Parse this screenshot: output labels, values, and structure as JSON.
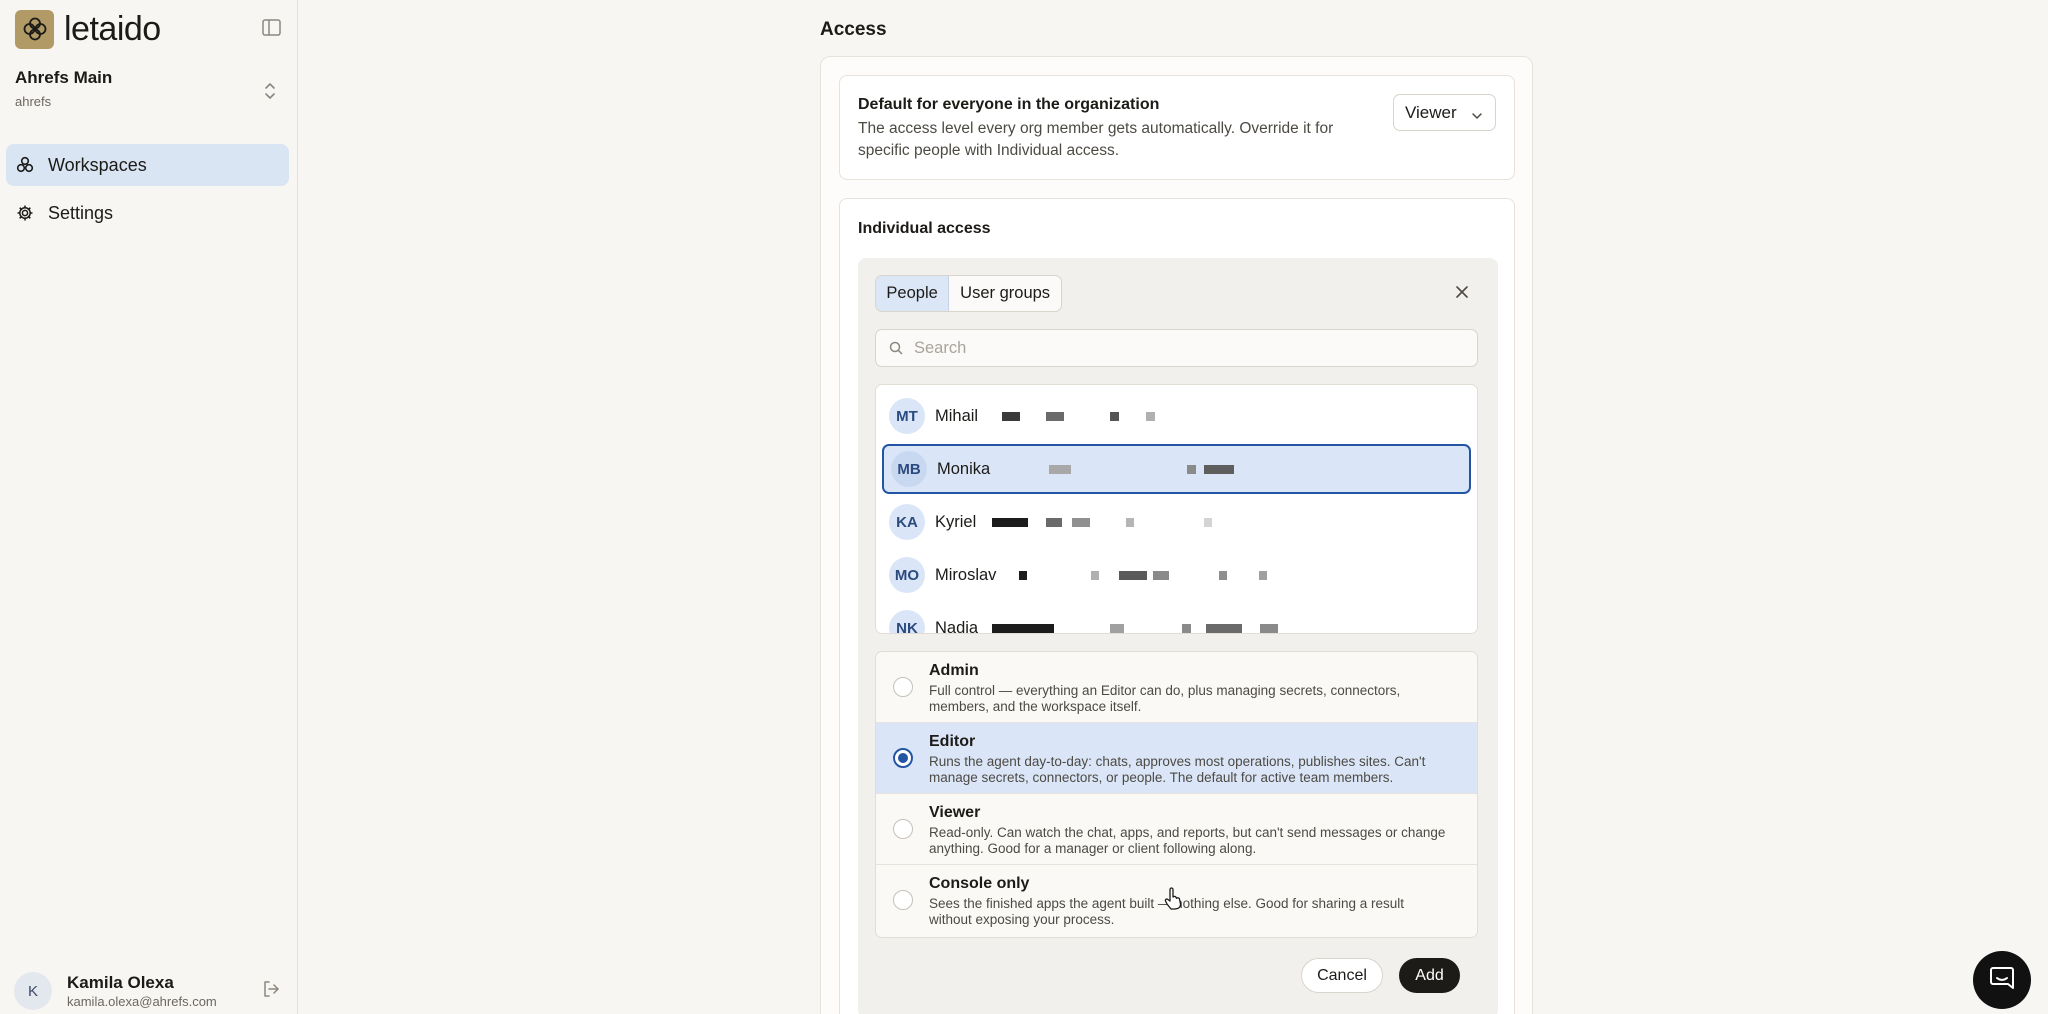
{
  "brand": {
    "name": "letaido",
    "logo_color": "#b19a66"
  },
  "org": {
    "name": "Ahrefs Main",
    "slug": "ahrefs"
  },
  "nav": [
    {
      "label": "Workspaces",
      "icon": "workspaces-icon",
      "active": true
    },
    {
      "label": "Settings",
      "icon": "gear-icon",
      "active": false
    }
  ],
  "user": {
    "initial": "K",
    "name": "Kamila Olexa",
    "email": "kamila.olexa@ahrefs.com"
  },
  "page": {
    "title": "Access"
  },
  "default_access": {
    "title": "Default for everyone in the organization",
    "description": "The access level every org member gets automatically. Override it for specific people with Individual access.",
    "value": "Viewer"
  },
  "individual": {
    "title": "Individual access",
    "tabs": [
      {
        "label": "People",
        "active": true
      },
      {
        "label": "User groups",
        "active": false
      }
    ],
    "search_placeholder": "Search",
    "people": [
      {
        "initials": "MT",
        "name": "Mihail",
        "selected": false
      },
      {
        "initials": "MB",
        "name": "Monika",
        "selected": true
      },
      {
        "initials": "KA",
        "name": "Kyriel",
        "selected": false
      },
      {
        "initials": "MO",
        "name": "Miroslav",
        "selected": false
      },
      {
        "initials": "NK",
        "name": "Nadia",
        "selected": false
      }
    ],
    "roles": [
      {
        "name": "Admin",
        "description": "Full control — everything an Editor can do, plus managing secrets, connectors, members, and the workspace itself.",
        "selected": false
      },
      {
        "name": "Editor",
        "description": "Runs the agent day-to-day: chats, approves most operations, publishes sites. Can't manage secrets, connectors, or people. The default for active team members.",
        "selected": true
      },
      {
        "name": "Viewer",
        "description": "Read-only. Can watch the chat, apps, and reports, but can't send messages or change anything. Good for a manager or client following along.",
        "selected": false
      },
      {
        "name": "Console only",
        "description": "Sees the finished apps the agent built — nothing else. Good for sharing a result without exposing your process.",
        "selected": false
      }
    ],
    "cancel_label": "Cancel",
    "add_label": "Add"
  },
  "colors": {
    "accent": "#2455a5",
    "selection_bg": "#dae6f7",
    "primary_button": "#1c1b18"
  }
}
